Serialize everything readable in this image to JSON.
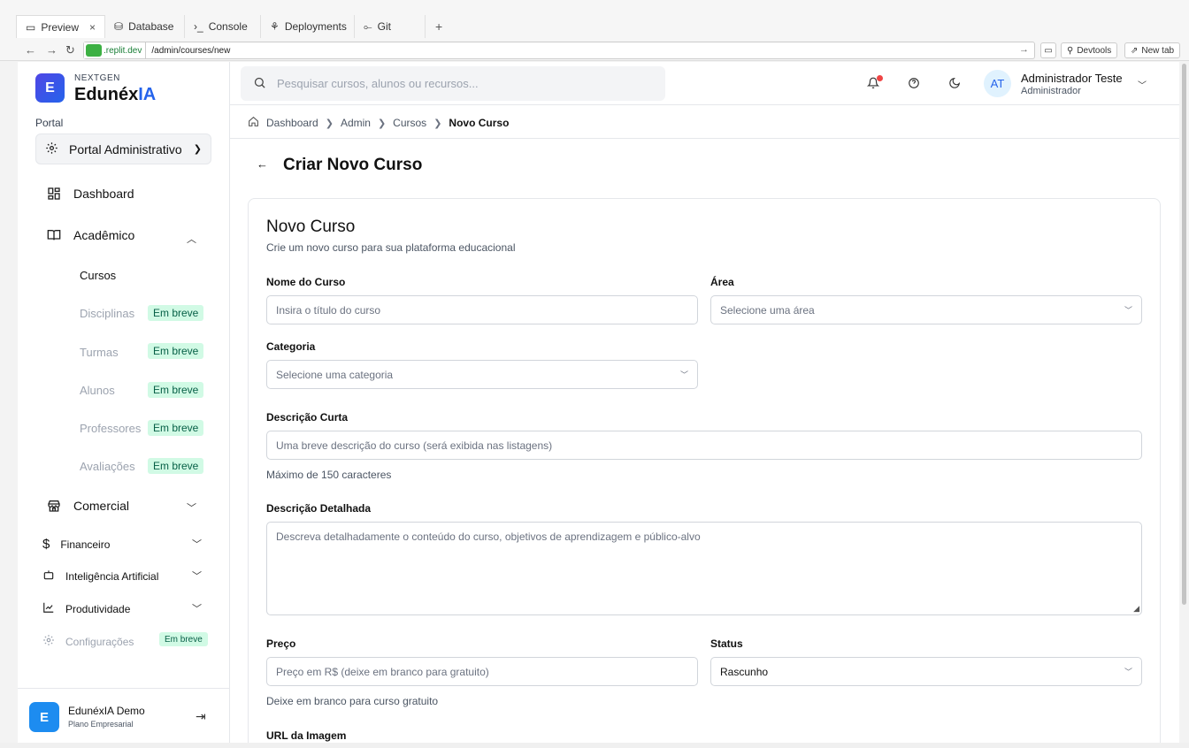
{
  "ide": {
    "tabs": [
      {
        "label": "Preview",
        "icon": "monitor-icon"
      },
      {
        "label": "Database",
        "icon": "database-icon"
      },
      {
        "label": "Console",
        "icon": "terminal-icon"
      },
      {
        "label": "Deployments",
        "icon": "deploy-icon"
      },
      {
        "label": "Git",
        "icon": "git-icon"
      }
    ],
    "close_glyph": "×",
    "plus_glyph": "+",
    "url_host": ".replit.dev",
    "url_path": "/admin/courses/new",
    "devtools_label": "Devtools",
    "newtab_label": "New tab"
  },
  "sidebar": {
    "logo_letter": "E",
    "brand_small": "NEXTGEN",
    "brand_main": "Edunéx",
    "brand_accent": "IA",
    "portal_label": "Portal",
    "portal_select": "Portal Administrativo",
    "items": {
      "dashboard": "Dashboard",
      "academico": "Acadêmico",
      "comercial": "Comercial",
      "financeiro": "Financeiro",
      "ia": "Inteligência Artificial",
      "produtividade": "Produtividade",
      "configuracoes": "Configurações"
    },
    "academico_sub": [
      {
        "label": "Cursos",
        "badge": ""
      },
      {
        "label": "Disciplinas",
        "badge": "Em breve"
      },
      {
        "label": "Turmas",
        "badge": "Em breve"
      },
      {
        "label": "Alunos",
        "badge": "Em breve"
      },
      {
        "label": "Professores",
        "badge": "Em breve"
      },
      {
        "label": "Avaliações",
        "badge": "Em breve"
      }
    ],
    "config_badge": "Em breve",
    "footer": {
      "avatar": "E",
      "name": "EdunéxIA Demo",
      "plan": "Plano Empresarial"
    }
  },
  "header": {
    "search_placeholder": "Pesquisar cursos, alunos ou recursos...",
    "user_initials": "AT",
    "user_name": "Administrador Teste",
    "user_role": "Administrador"
  },
  "breadcrumb": [
    "Dashboard",
    "Admin",
    "Cursos",
    "Novo Curso"
  ],
  "page": {
    "title": "Criar Novo Curso"
  },
  "form": {
    "title": "Novo Curso",
    "subtitle": "Crie um novo curso para sua plataforma educacional",
    "nome_label": "Nome do Curso",
    "nome_placeholder": "Insira o título do curso",
    "area_label": "Área",
    "area_placeholder": "Selecione uma área",
    "categoria_label": "Categoria",
    "categoria_placeholder": "Selecione uma categoria",
    "desc_curta_label": "Descrição Curta",
    "desc_curta_placeholder": "Uma breve descrição do curso (será exibida nas listagens)",
    "desc_curta_help": "Máximo de 150 caracteres",
    "desc_det_label": "Descrição Detalhada",
    "desc_det_placeholder": "Descreva detalhadamente o conteúdo do curso, objetivos de aprendizagem e público-alvo",
    "preco_label": "Preço",
    "preco_placeholder": "Preço em R$ (deixe em branco para gratuito)",
    "preco_help": "Deixe em branco para curso gratuito",
    "status_label": "Status",
    "status_value": "Rascunho",
    "url_label": "URL da Imagem"
  },
  "colors": {
    "accent": "#2563eb",
    "badge_bg": "#d1fae5",
    "notif": "#ef4444"
  }
}
